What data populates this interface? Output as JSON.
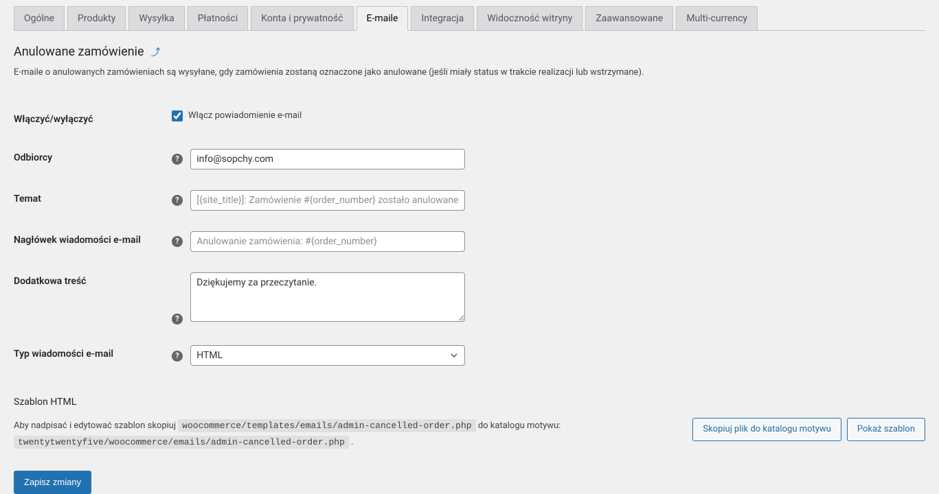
{
  "tabs": {
    "general": "Ogólne",
    "products": "Produkty",
    "shipping": "Wysyłka",
    "payments": "Płatności",
    "accounts": "Konta i prywatność",
    "emails": "E-maile",
    "integration": "Integracja",
    "site_visibility": "Widoczność witryny",
    "advanced": "Zaawansowane",
    "multi_currency": "Multi-currency"
  },
  "page": {
    "title": "Anulowane zamówienie",
    "description": "E-maile o anulowanych zamówieniach są wysyłane, gdy zamówienia zostaną oznaczone jako anulowane (jeśli miały status w trakcie realizacji lub wstrzymane)."
  },
  "fields": {
    "enable": {
      "label": "Włączyć/wyłączyć",
      "checkbox_label": "Włącz powiadomienie e-mail",
      "checked": true
    },
    "recipients": {
      "label": "Odbiorcy",
      "value": "info@sopchy.com"
    },
    "subject": {
      "label": "Temat",
      "placeholder": "[{site_title}]: Zamówienie #{order_number} zostało anulowane",
      "value": ""
    },
    "heading": {
      "label": "Nagłówek wiadomości e-mail",
      "placeholder": "Anulowanie zamówienia: #{order_number}",
      "value": ""
    },
    "additional": {
      "label": "Dodatkowa treść",
      "value": "Dziękujemy za przeczytanie."
    },
    "email_type": {
      "label": "Typ wiadomości e-mail",
      "value": "HTML"
    }
  },
  "template": {
    "header": "Szablon HTML",
    "text_part1": "Aby nadpisać i edytować szablon skopiuj ",
    "code1": "woocommerce/templates/emails/admin-cancelled-order.php",
    "text_part2": " do katalogu motywu: ",
    "code2": "twentytwentyfive/woocommerce/emails/admin-cancelled-order.php",
    "text_part3": " .",
    "copy_button": "Skopiuj plik do katalogu motywu",
    "show_button": "Pokaż szablon"
  },
  "submit": "Zapisz zmiany",
  "help_tip": "?"
}
